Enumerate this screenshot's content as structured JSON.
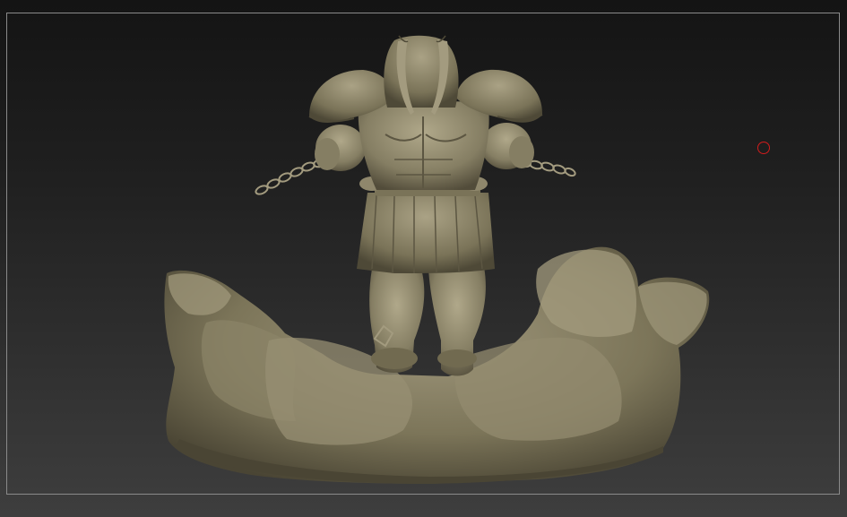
{
  "viewport": {
    "background_top": "#141414",
    "background_bottom": "#3e3e3e",
    "frame_color": "#8a8a8a"
  },
  "model": {
    "material_color": "#8f876c",
    "shadow_color": "#4e4937",
    "highlight_color": "#bab396"
  },
  "cursor": {
    "icon": "brush-circle-icon",
    "color": "#d21c1c"
  }
}
